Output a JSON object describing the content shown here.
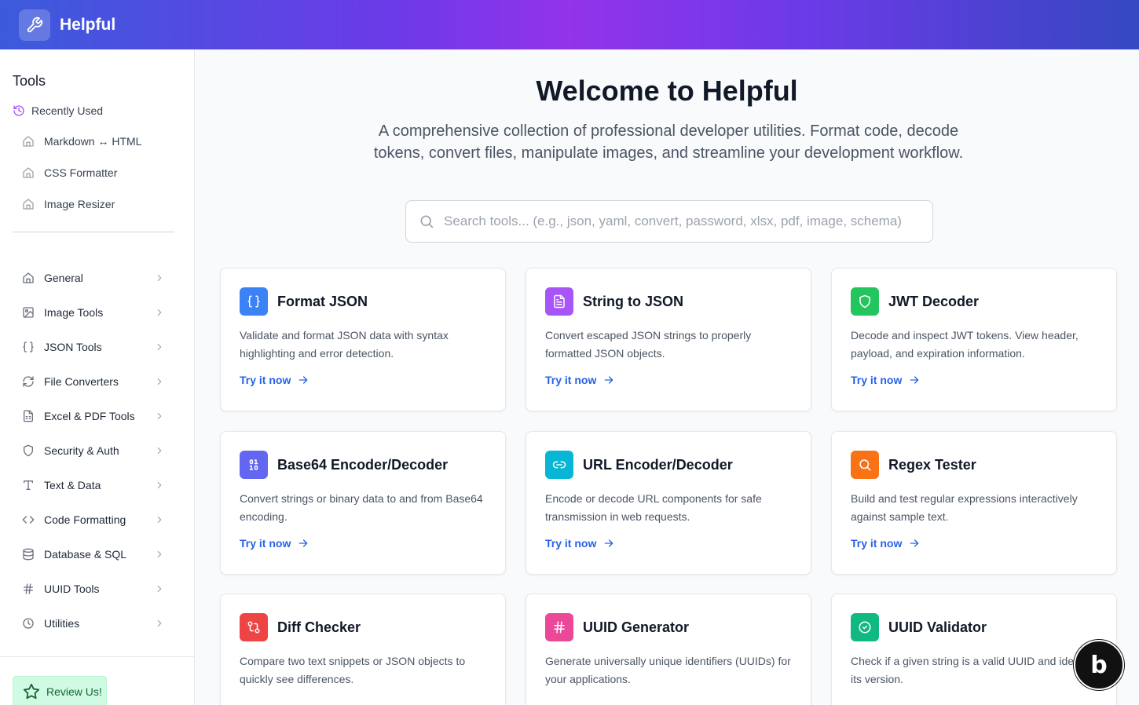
{
  "app": {
    "name": "Helpful"
  },
  "sidebar": {
    "title": "Tools",
    "recent_label": "Recently Used",
    "recent": [
      {
        "label": "Markdown ↔ HTML"
      },
      {
        "label": "CSS Formatter"
      },
      {
        "label": "Image Resizer"
      }
    ],
    "categories": [
      {
        "label": "General",
        "icon": "home-icon"
      },
      {
        "label": "Image Tools",
        "icon": "image-icon"
      },
      {
        "label": "JSON Tools",
        "icon": "braces-icon"
      },
      {
        "label": "File Converters",
        "icon": "refresh-icon"
      },
      {
        "label": "Excel & PDF Tools",
        "icon": "spreadsheet-icon"
      },
      {
        "label": "Security & Auth",
        "icon": "shield-icon"
      },
      {
        "label": "Text & Data",
        "icon": "text-icon"
      },
      {
        "label": "Code Formatting",
        "icon": "code-icon"
      },
      {
        "label": "Database & SQL",
        "icon": "database-icon"
      },
      {
        "label": "UUID Tools",
        "icon": "hash-icon"
      },
      {
        "label": "Utilities",
        "icon": "clock-icon"
      }
    ],
    "review_label": "Review Us!"
  },
  "main": {
    "title": "Welcome to Helpful",
    "subtitle": "A comprehensive collection of professional developer utilities. Format code, decode tokens, convert files, manipulate images, and streamline your development workflow.",
    "search_placeholder": "Search tools... (e.g., json, yaml, convert, password, xlsx, pdf, image, schema)",
    "cta_label": "Try it now",
    "cards": [
      {
        "title": "Format JSON",
        "desc": "Validate and format JSON data with syntax highlighting and error detection.",
        "color": "#3b82f6",
        "icon": "braces-icon"
      },
      {
        "title": "String to JSON",
        "desc": "Convert escaped JSON strings to properly formatted JSON objects.",
        "color": "#a855f7",
        "icon": "file-text-icon"
      },
      {
        "title": "JWT Decoder",
        "desc": "Decode and inspect JWT tokens. View header, payload, and expiration information.",
        "color": "#22c55e",
        "icon": "shield-icon"
      },
      {
        "title": "Base64 Encoder/Decoder",
        "desc": "Convert strings or binary data to and from Base64 encoding.",
        "color": "#6366f1",
        "icon": "binary-icon"
      },
      {
        "title": "URL Encoder/Decoder",
        "desc": "Encode or decode URL components for safe transmission in web requests.",
        "color": "#06b6d4",
        "icon": "link-icon"
      },
      {
        "title": "Regex Tester",
        "desc": "Build and test regular expressions interactively against sample text.",
        "color": "#f97316",
        "icon": "search-icon"
      },
      {
        "title": "Diff Checker",
        "desc": "Compare two text snippets or JSON objects to quickly see differences.",
        "color": "#ef4444",
        "icon": "git-compare-icon"
      },
      {
        "title": "UUID Generator",
        "desc": "Generate universally unique identifiers (UUIDs) for your applications.",
        "color": "#ec4899",
        "icon": "hash-icon"
      },
      {
        "title": "UUID Validator",
        "desc": "Check if a given string is a valid UUID and identify its version.",
        "color": "#10b981",
        "icon": "check-circle-icon"
      }
    ]
  },
  "badge": {
    "text": "b"
  }
}
